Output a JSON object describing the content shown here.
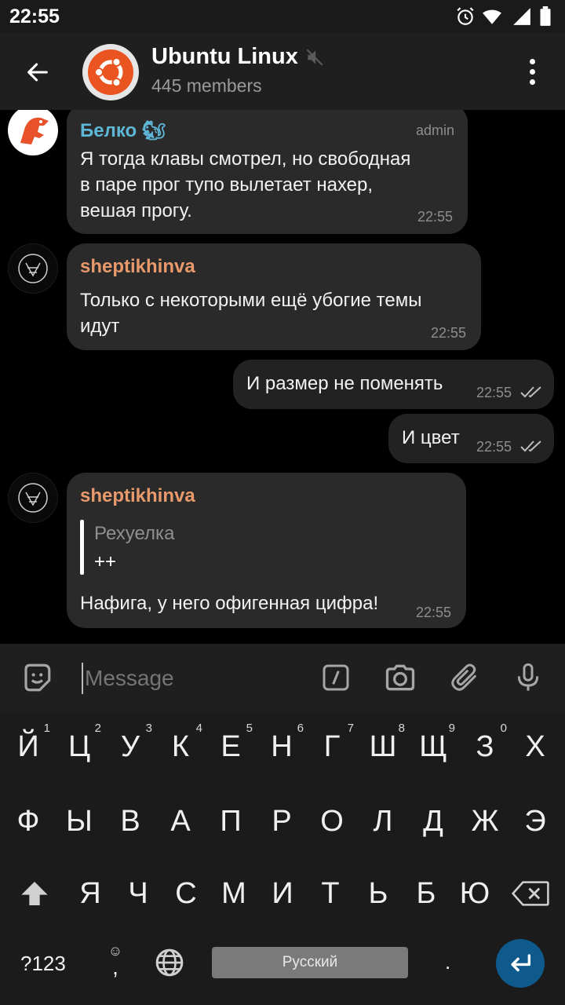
{
  "status_bar": {
    "time": "22:55",
    "icons": [
      "alarm-icon",
      "wifi-icon",
      "signal-icon",
      "battery-icon"
    ]
  },
  "header": {
    "title": "Ubuntu Linux",
    "subtitle": "445 members",
    "avatar": "ubuntu-logo",
    "muted": true
  },
  "messages": [
    {
      "sender": "Белко 🐿",
      "sender_color": "#5fb7d8",
      "tag": "admin",
      "lines": [
        "Я тогда клавы смотрел, но свободная",
        "в паре прог тупо вылетает нахер,",
        "вешая прогу."
      ],
      "time": "22:55",
      "direction": "in"
    },
    {
      "sender": "sheptikhinva",
      "sender_color": "#e89a6c",
      "lines": [
        "Только с некоторыми ещё убогие темы",
        "идут"
      ],
      "time": "22:55",
      "direction": "in"
    },
    {
      "text": "И размер не поменять",
      "time": "22:55",
      "direction": "out",
      "read": true
    },
    {
      "text": "И цвет",
      "time": "22:55",
      "direction": "out",
      "read": true
    },
    {
      "sender": "sheptikhinva",
      "sender_color": "#e89a6c",
      "reply": {
        "name": "Рехуелка",
        "text": "++"
      },
      "text": "Нафига, у него офигенная цифра!",
      "time": "22:55",
      "direction": "in"
    }
  ],
  "composer": {
    "placeholder": "Message"
  },
  "keyboard": {
    "row1": [
      {
        "k": "Й",
        "h": "1"
      },
      {
        "k": "Ц",
        "h": "2"
      },
      {
        "k": "У",
        "h": "3"
      },
      {
        "k": "К",
        "h": "4"
      },
      {
        "k": "Е",
        "h": "5"
      },
      {
        "k": "Н",
        "h": "6"
      },
      {
        "k": "Г",
        "h": "7"
      },
      {
        "k": "Ш",
        "h": "8"
      },
      {
        "k": "Щ",
        "h": "9"
      },
      {
        "k": "З",
        "h": "0"
      },
      {
        "k": "Х",
        "h": ""
      }
    ],
    "row2": [
      "Ф",
      "Ы",
      "В",
      "А",
      "П",
      "Р",
      "О",
      "Л",
      "Д",
      "Ж",
      "Э"
    ],
    "row3": [
      "Я",
      "Ч",
      "С",
      "М",
      "И",
      "Т",
      "Ь",
      "Б",
      "Ю"
    ],
    "symbols_label": "?123",
    "comma": ",",
    "period": ".",
    "space_label": "Русский"
  }
}
